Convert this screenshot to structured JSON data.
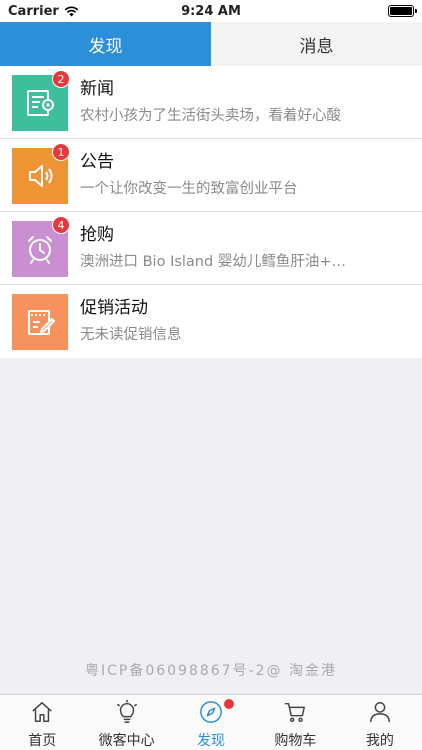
{
  "status_bar": {
    "carrier": "Carrier",
    "time": "9:24 AM"
  },
  "segments": [
    {
      "label": "发现",
      "active": true
    },
    {
      "label": "消息",
      "active": false
    }
  ],
  "items": [
    {
      "title": "新闻",
      "subtitle": "农村小孩为了生活街头卖场，看着好心酸",
      "badge": "2",
      "icon": "news-icon",
      "color": "#3dbf9c"
    },
    {
      "title": "公告",
      "subtitle": "一个让你改变一生的致富创业平台",
      "badge": "1",
      "icon": "speaker-icon",
      "color": "#ee9435"
    },
    {
      "title": "抢购",
      "subtitle": "澳洲进口 Bio Island 婴幼儿鳕鱼肝油+…",
      "badge": "4",
      "icon": "alarm-clock-icon",
      "color": "#c98fd0"
    },
    {
      "title": "促销活动",
      "subtitle": "无未读促销信息",
      "badge": "",
      "icon": "promotion-icon",
      "color": "#f7925f"
    }
  ],
  "footer": {
    "icp": "粤ICP备06098867号-2@ 淘金港"
  },
  "tabs": [
    {
      "label": "首页",
      "icon": "home-icon"
    },
    {
      "label": "微客中心",
      "icon": "lightbulb-icon"
    },
    {
      "label": "发现",
      "icon": "compass-icon"
    },
    {
      "label": "购物车",
      "icon": "cart-icon"
    },
    {
      "label": "我的",
      "icon": "profile-icon"
    }
  ],
  "accent": "#2b90d9",
  "badge_color": "#e4393c"
}
